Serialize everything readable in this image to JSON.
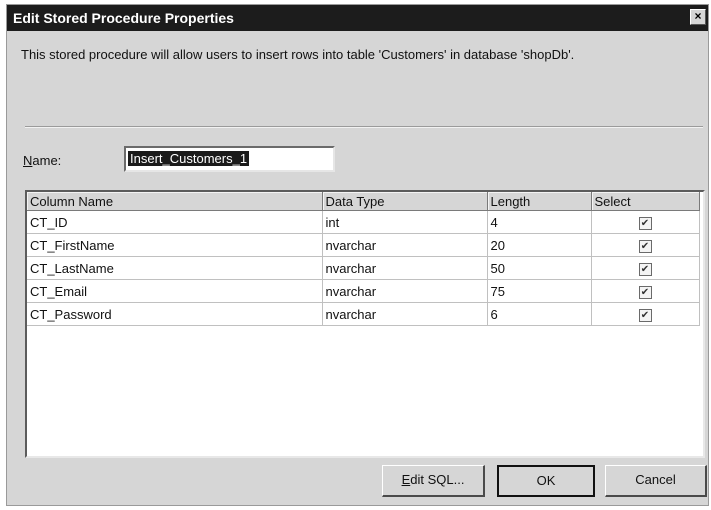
{
  "window": {
    "title": "Edit Stored Procedure Properties",
    "close_glyph": "×"
  },
  "description": "This stored procedure will allow users to insert rows into table 'Customers' in database 'shopDb'.",
  "name_field": {
    "label_first": "N",
    "label_rest": "ame:",
    "value": "Insert_Customers_1"
  },
  "grid": {
    "headers": [
      "Column Name",
      "Data Type",
      "Length",
      "Select"
    ],
    "rows": [
      {
        "column": "CT_ID",
        "type": "int",
        "length": "4",
        "selected": true
      },
      {
        "column": "CT_FirstName",
        "type": "nvarchar",
        "length": "20",
        "selected": true
      },
      {
        "column": "CT_LastName",
        "type": "nvarchar",
        "length": "50",
        "selected": true
      },
      {
        "column": "CT_Email",
        "type": "nvarchar",
        "length": "75",
        "selected": true
      },
      {
        "column": "CT_Password",
        "type": "nvarchar",
        "length": "6",
        "selected": true
      }
    ],
    "check_glyph": "✔"
  },
  "buttons": {
    "edit_sql_first": "E",
    "edit_sql_rest": "dit SQL...",
    "ok": "OK",
    "cancel": "Cancel"
  }
}
